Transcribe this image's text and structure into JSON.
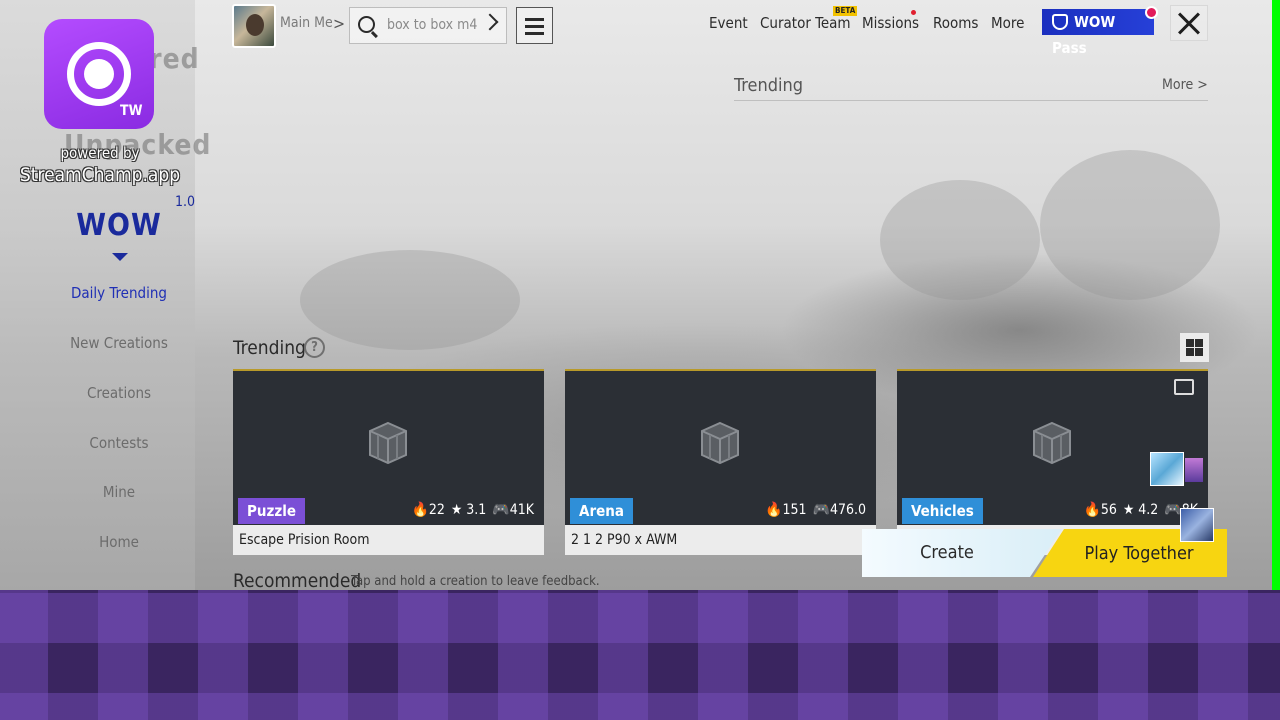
{
  "sidebar": {
    "ghost_title_1": "Featured",
    "ghost_title_2": "Unpacked",
    "logo": "WOW",
    "version": "1.0",
    "items": [
      {
        "label": "Daily Trending",
        "active": true
      },
      {
        "label": "New Creations"
      },
      {
        "label": "Creations"
      },
      {
        "label": "Contests"
      },
      {
        "label": "Mine"
      },
      {
        "label": "Home"
      }
    ]
  },
  "topbar": {
    "breadcrumb": "Main Menu",
    "search_value": "box to box m4",
    "links": {
      "event": "Event",
      "curator_team": "Curator Team",
      "missions": "Missions",
      "rooms": "Rooms",
      "more": "More"
    },
    "beta_badge": "BETA",
    "wow_pass": "WOW Pass"
  },
  "trending_panel": {
    "title": "Trending",
    "more_label": "More"
  },
  "trending": {
    "label": "Trending",
    "help": "?",
    "cards": [
      {
        "tag": "Puzzle",
        "tag_color": "#7b4fd6",
        "hot": "22",
        "rating": "3.1",
        "plays": "41K",
        "title": "Escape Prision Room"
      },
      {
        "tag": "Arena",
        "tag_color": "#2f8fd8",
        "hot": "151",
        "rating": "",
        "plays": "476.0",
        "title": "2 1 2  P90 x AWM"
      },
      {
        "tag": "Vehicles",
        "tag_color": "#2f8fd8",
        "hot": "56",
        "rating": "4.2",
        "plays": "8K",
        "title": ""
      }
    ]
  },
  "recommended": {
    "label": "Recommended",
    "hint": "Tap and hold a creation to leave feedback."
  },
  "actions": {
    "create": "Create",
    "play_together": "Play Together"
  },
  "overlay": {
    "badge": "TW",
    "powered_by": "powered by",
    "domain": "StreamChamp.app"
  },
  "colors": {
    "accent": "#1a2a9c",
    "wow_pass_bg": "#2640d8",
    "play_together_bg": "#f7d511",
    "chroma_green": "#00ff00",
    "banner_purple": "#3a2560"
  },
  "icons": [
    "search-icon",
    "menu-icon",
    "close-icon",
    "help-icon",
    "grid-icon",
    "box-icon",
    "flame-icon",
    "star-icon",
    "gamepad-icon",
    "chat-icon"
  ]
}
